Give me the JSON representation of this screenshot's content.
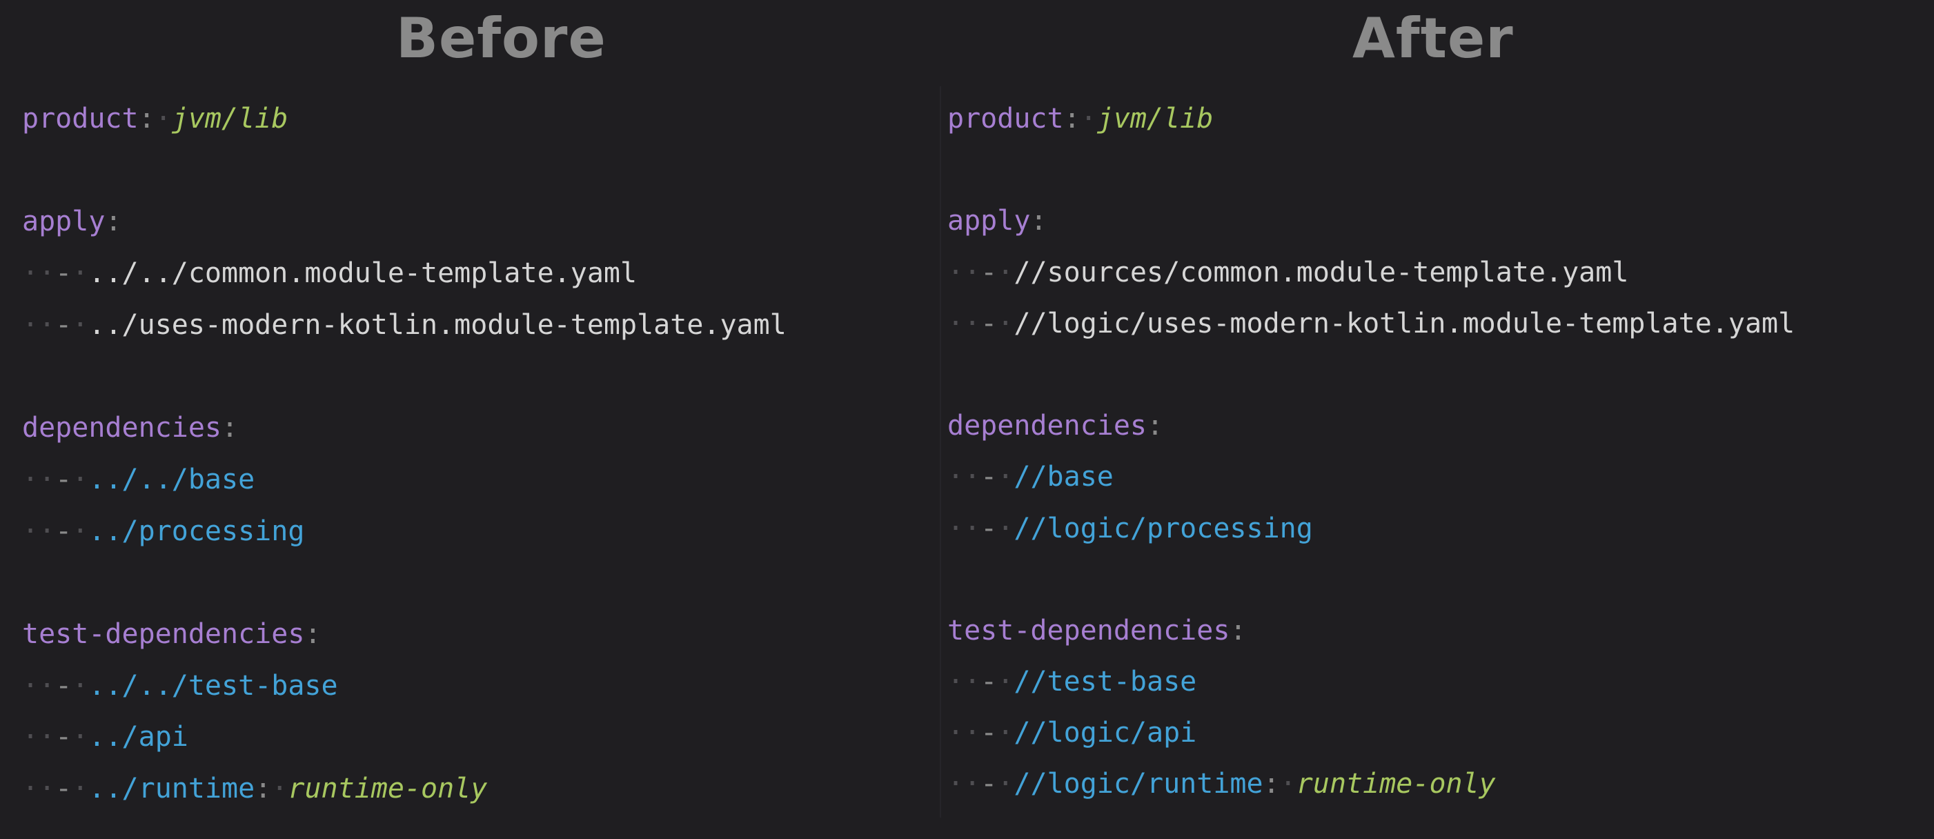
{
  "before": {
    "header": "Before",
    "lines": [
      {
        "key": "product",
        "colon": ":",
        "ws": "·",
        "value": "jvm/lib"
      },
      {},
      {
        "key": "apply",
        "colon": ":"
      },
      {
        "indent": "··",
        "dash": "-",
        "ws": "·",
        "item": "../../common.module-template.yaml",
        "kind": "s"
      },
      {
        "indent": "··",
        "dash": "-",
        "ws": "·",
        "item": "../uses-modern-kotlin.module-template.yaml",
        "kind": "s"
      },
      {},
      {
        "key": "dependencies",
        "colon": ":"
      },
      {
        "indent": "··",
        "dash": "-",
        "ws": "·",
        "item": "../../base",
        "kind": "dep"
      },
      {
        "indent": "··",
        "dash": "-",
        "ws": "·",
        "item": "../processing",
        "kind": "dep"
      },
      {},
      {
        "key": "test-dependencies",
        "colon": ":"
      },
      {
        "indent": "··",
        "dash": "-",
        "ws": "·",
        "item": "../../test-base",
        "kind": "dep"
      },
      {
        "indent": "··",
        "dash": "-",
        "ws": "·",
        "item": "../api",
        "kind": "dep"
      },
      {
        "indent": "··",
        "dash": "-",
        "ws": "·",
        "item": "../runtime",
        "kind": "dep",
        "colon": ":",
        "ws2": "·",
        "value": "runtime-only"
      }
    ]
  },
  "after": {
    "header": "After",
    "lines": [
      {
        "key": "product",
        "colon": ":",
        "ws": "·",
        "value": "jvm/lib"
      },
      {},
      {
        "key": "apply",
        "colon": ":"
      },
      {
        "indent": "··",
        "dash": "-",
        "ws": "·",
        "item": "//sources/common.module-template.yaml",
        "kind": "s"
      },
      {
        "indent": "··",
        "dash": "-",
        "ws": "·",
        "item": "//logic/uses-modern-kotlin.module-template.yaml",
        "kind": "s"
      },
      {},
      {
        "key": "dependencies",
        "colon": ":"
      },
      {
        "indent": "··",
        "dash": "-",
        "ws": "·",
        "item": "//base",
        "kind": "dep"
      },
      {
        "indent": "··",
        "dash": "-",
        "ws": "·",
        "item": "//logic/processing",
        "kind": "dep"
      },
      {},
      {
        "key": "test-dependencies",
        "colon": ":"
      },
      {
        "indent": "··",
        "dash": "-",
        "ws": "·",
        "item": "//test-base",
        "kind": "dep"
      },
      {
        "indent": "··",
        "dash": "-",
        "ws": "·",
        "item": "//logic/api",
        "kind": "dep"
      },
      {
        "indent": "··",
        "dash": "-",
        "ws": "·",
        "item": "//logic/runtime",
        "kind": "dep",
        "colon": ":",
        "ws2": "·",
        "value": "runtime-only"
      }
    ]
  }
}
